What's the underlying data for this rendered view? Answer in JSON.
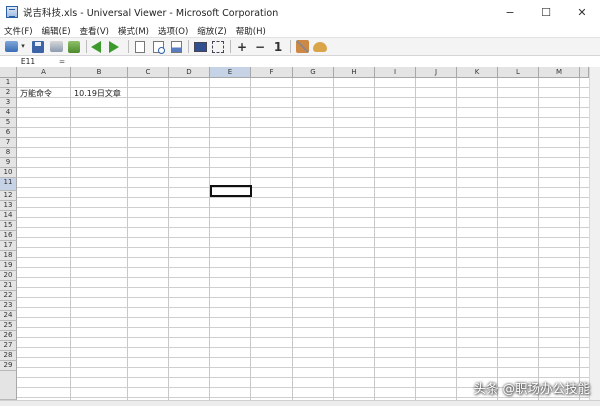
{
  "window": {
    "title": "说吉科技.xls - Universal Viewer - Microsoft Corporation",
    "controls": [
      "−",
      "☐",
      "✕"
    ]
  },
  "menu": [
    "文件(F)",
    "编辑(E)",
    "查看(V)",
    "模式(M)",
    "选项(O)",
    "缩放(Z)",
    "帮助(H)"
  ],
  "toolbar": {
    "icons": [
      "open-icon",
      "dropdown-icon",
      "save-icon",
      "print-icon",
      "zip-icon",
      "back-icon",
      "forward-icon",
      "page-icon",
      "find-icon",
      "export-icon",
      "screen-icon",
      "fullscreen-icon",
      "zoom-in-icon",
      "zoom-out-icon",
      "actual-size-icon",
      "tools-icon",
      "plugin-icon"
    ],
    "zoom_in": "+",
    "zoom_out": "−",
    "actual_size": "1"
  },
  "formula_bar": {
    "name_box": "E11",
    "equals": "="
  },
  "sheet": {
    "columns": [
      "A",
      "B",
      "C",
      "D",
      "E",
      "F",
      "G",
      "H",
      "I",
      "J",
      "K",
      "L",
      "M"
    ],
    "rows": [
      "1",
      "2",
      "3",
      "4",
      "5",
      "6",
      "7",
      "8",
      "9",
      "10",
      "11",
      "12",
      "13",
      "14",
      "15",
      "16",
      "17",
      "18",
      "19",
      "20",
      "21",
      "22",
      "23",
      "24",
      "25",
      "26",
      "27",
      "28",
      "29"
    ],
    "active_cell": "E11",
    "cells": {
      "A2": "万能命令",
      "B2": "10.19日文章"
    }
  },
  "watermark": "头条 @职场办公技能"
}
